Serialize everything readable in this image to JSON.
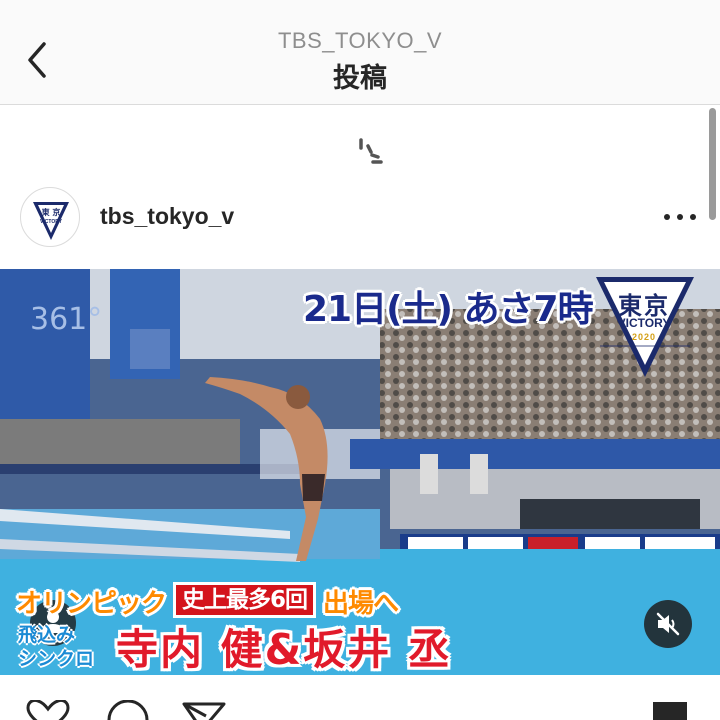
{
  "header": {
    "account": "TBS_TOKYO_V",
    "title": "投稿"
  },
  "post": {
    "username": "tbs_tokyo_v",
    "avatar_logo": {
      "line1": "東 京",
      "line2": "VICTORY"
    },
    "video": {
      "broadcast": "21日(土) あさ7時",
      "logo": {
        "line1": "東京",
        "line2": "VICTORY",
        "line3": "2020"
      },
      "caption_line1_a": "オリンピック",
      "caption_line1_box": "史上最多6回",
      "caption_line1_b": "出場へ",
      "caption_small_1": "飛込み",
      "caption_small_2": "シンクロ",
      "caption_names": "寺内 健&坂井 丞",
      "scoreboard": "361°"
    }
  },
  "colors": {
    "header_bg": "#fafafa",
    "divider": "#dbdbdb",
    "text_primary": "#262626",
    "text_secondary": "#8e8e8e",
    "caption_orange": "#ff8a00",
    "caption_red": "#e11a2a",
    "broadcast_blue": "#1a2a8c"
  }
}
